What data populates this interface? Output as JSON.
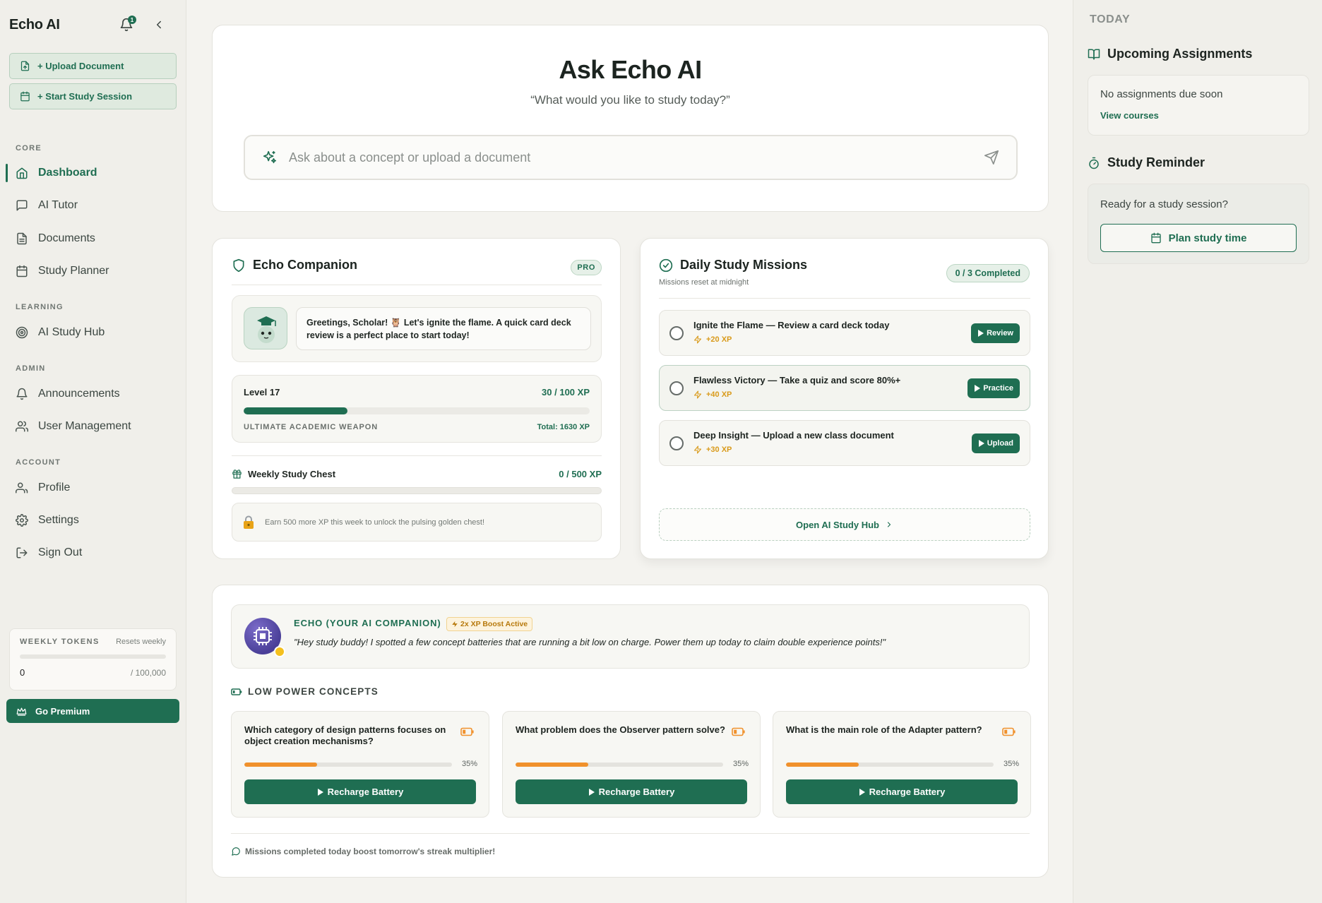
{
  "app": {
    "title": "Echo AI",
    "notification_count": "1"
  },
  "sidebar": {
    "actions": [
      {
        "label": "+ Upload Document",
        "icon": "file-upload-icon"
      },
      {
        "label": "+ Start Study Session",
        "icon": "calendar-icon"
      }
    ],
    "sections": {
      "core": "CORE",
      "learning": "LEARNING",
      "admin": "ADMIN",
      "account": "ACCOUNT"
    },
    "items": [
      {
        "label": "Dashboard",
        "icon": "home-icon",
        "active": true
      },
      {
        "label": "AI Tutor",
        "icon": "chat-icon"
      },
      {
        "label": "Documents",
        "icon": "document-icon"
      },
      {
        "label": "Study Planner",
        "icon": "calendar-icon"
      },
      {
        "label": "AI Study Hub",
        "icon": "target-icon"
      },
      {
        "label": "Announcements",
        "icon": "bell-icon"
      },
      {
        "label": "User Management",
        "icon": "users-icon"
      },
      {
        "label": "Profile",
        "icon": "user-icon"
      },
      {
        "label": "Settings",
        "icon": "gear-icon"
      },
      {
        "label": "Sign Out",
        "icon": "sign-out-icon"
      }
    ],
    "tokens": {
      "label": "WEEKLY TOKENS",
      "reset": "Resets weekly",
      "value": "0",
      "max": "/ 100,000",
      "used_fraction": 0
    },
    "premium": "Go Premium"
  },
  "ask": {
    "title": "Ask Echo AI",
    "subtitle": "“What would you like to study today?”",
    "placeholder": "Ask about a concept or upload a document"
  },
  "companion": {
    "title": "Echo Companion",
    "badge": "PRO",
    "greeting": "Greetings, Scholar! 🦉 Let's ignite the flame. A quick card deck review is a perfect place to start today!",
    "level": "Level 17",
    "level_xp": "30 / 100 XP",
    "level_fraction": 0.3,
    "rank": "ULTIMATE ACADEMIC WEAPON",
    "total": "Total: 1630 XP",
    "chest_title": "Weekly Study Chest",
    "chest_xp": "0 / 500 XP",
    "chest_fraction": 0,
    "chest_note": "Earn 500 more XP this week to unlock the pulsing golden chest!"
  },
  "missions": {
    "title": "Daily Study Missions",
    "subtitle": "Missions reset at midnight",
    "completed": "0 / 3 Completed",
    "items": [
      {
        "title": "Ignite the Flame — Review a card deck today",
        "xp": "+20 XP",
        "button": "Review"
      },
      {
        "title": "Flawless Victory — Take a quiz and score 80%+",
        "xp": "+40 XP",
        "button": "Practice"
      },
      {
        "title": "Deep Insight — Upload a new class document",
        "xp": "+30 XP",
        "button": "Upload"
      }
    ],
    "hub_link": "Open AI Study Hub"
  },
  "echo": {
    "name": "ECHO (YOUR AI COMPANION)",
    "boost": "2x XP Boost Active",
    "quote": "\"Hey study buddy! I spotted a few concept batteries that are running a bit low on charge. Power them up today to claim double experience points!\"",
    "low_power_title": "LOW POWER CONCEPTS",
    "concepts": [
      {
        "question": "Which category of design patterns focuses on object creation mechanisms?",
        "pct": "35%",
        "fraction": 0.35,
        "button": "Recharge Battery"
      },
      {
        "question": "What problem does the Observer pattern solve?",
        "pct": "35%",
        "fraction": 0.35,
        "button": "Recharge Battery"
      },
      {
        "question": "What is the main role of the Adapter pattern?",
        "pct": "35%",
        "fraction": 0.35,
        "button": "Recharge Battery"
      }
    ],
    "footer": "Missions completed today boost tomorrow's streak multiplier!"
  },
  "right": {
    "today": "TODAY",
    "assignments_title": "Upcoming Assignments",
    "assignments_empty": "No assignments due soon",
    "view_courses": "View courses",
    "reminder_title": "Study Reminder",
    "reminder_text": "Ready for a study session?",
    "plan_button": "Plan study time"
  },
  "colors": {
    "accent": "#1f6e52",
    "warning": "#f0912c",
    "xp": "#d99a1a"
  }
}
